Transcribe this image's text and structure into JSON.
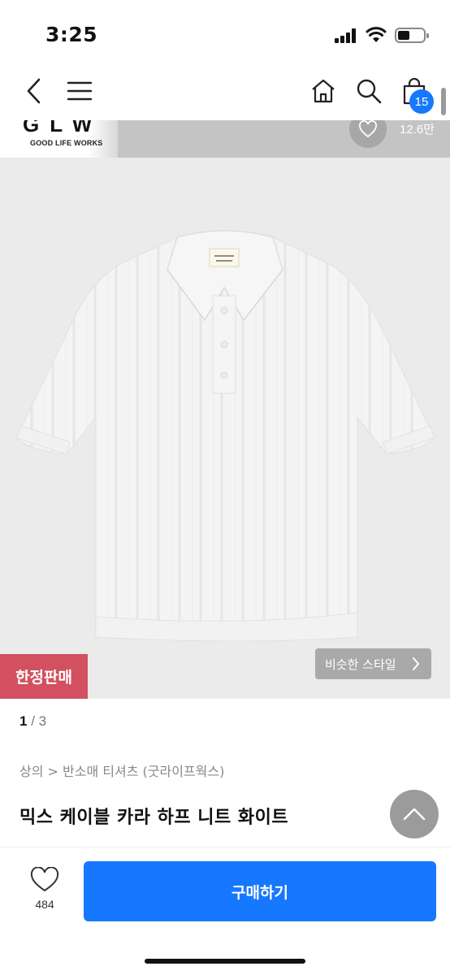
{
  "status_bar": {
    "time": "3:25"
  },
  "nav": {
    "cart_count": "15"
  },
  "brand": {
    "logo": "GLW",
    "tagline": "GOOD LIFE WORKS"
  },
  "wish_top": {
    "count": "12.6만"
  },
  "product": {
    "limited_badge": "한정판매",
    "similar_style": "비슷한 스타일",
    "pager_current": "1",
    "pager_separator": " / ",
    "pager_total": "3",
    "breadcrumb": "상의 > 반소매 티셔츠 (굿라이프웍스)",
    "title": "믹스 케이블 카라 하프 니트 화이트"
  },
  "bottom": {
    "like_count": "484",
    "buy_label": "구매하기"
  },
  "colors": {
    "accent": "#1677ff",
    "limited": "#d2505f"
  }
}
